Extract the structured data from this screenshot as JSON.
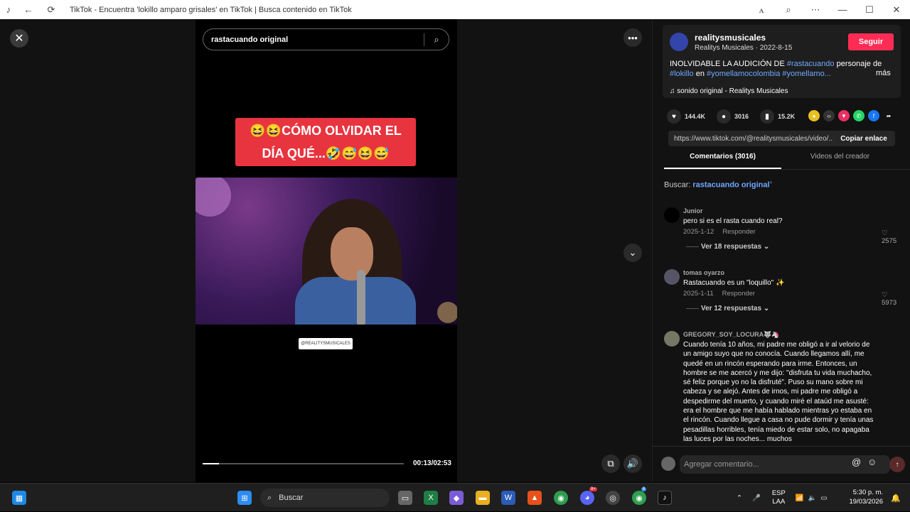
{
  "browser": {
    "title": "TikTok - Encuentra 'lokillo amparo grisales' en TikTok | Busca contenido en TikTok",
    "icons": [
      "tiktok-icon",
      "back-icon",
      "refresh-icon",
      "translate-icon",
      "zoom-icon",
      "more-icon",
      "minimize-icon",
      "maximize-icon",
      "close-icon"
    ]
  },
  "player": {
    "search_query": "rastacuando original",
    "caption_line1": "😆😆CÓMO OLVIDAR EL",
    "caption_line2": "DÍA QUÉ...🤣😅😆😅",
    "watermark": "@REALITYSMUSICALES",
    "progress": 0.08,
    "time": "00:13/02:53"
  },
  "creator": {
    "username": "realitysmusicales",
    "subtitle": "Realitys Musicales · 2022-8-15",
    "follow_label": "Seguir",
    "description_pre": "INOLVIDABLE LA AUDICIÓN DE ",
    "hashtag1": "#rastacuando",
    "description_mid": " personaje de ",
    "hashtag2": "#lokillo",
    "description_mid2": " en ",
    "hashtag3": "#yomellamocolombia",
    "hashtag4": " #yomellamo...",
    "more_label": "más",
    "sound": "♫  sonido original - Realitys Musicales"
  },
  "stats": {
    "likes": "144.4K",
    "comments": "3016",
    "saves": "15.2K"
  },
  "share": {
    "url": "https://www.tiktok.com/@realitysmusicales/video/...",
    "copy_label": "Copiar enlace"
  },
  "tabs": {
    "comments": "Comentarios (3016)",
    "creator_videos": "Videos del creador"
  },
  "search_label": "Buscar: ",
  "search_term": "rastacuando original",
  "comments": [
    {
      "user": "Junior",
      "text": "pero si es el rasta cuando real?",
      "date": "2025-1-12",
      "reply": "Responder",
      "likes": "♡ 2575",
      "view_replies": "Ver 18 respuestas ⌄"
    },
    {
      "user": "tomas oyarzo",
      "text": "Rastacuando es un \"loquillo\" ✨",
      "date": "2025-1-11",
      "reply": "Responder",
      "likes": "♡ 5973",
      "view_replies": "Ver 12 respuestas ⌄"
    },
    {
      "user": "GREGORY_SOY_LOCURA🐺🦄",
      "text": "Cuando tenía 10 años, mi padre me obligó a ir al velorio de un amigo suyo que no conocía. Cuando llegamos allí, me quedé en un rincón esperando para irme. Entonces, un hombre se me acercó y me dijo: \"disfruta tu vida muchacho, sé feliz porque yo no la disfruté\". Puso su mano sobre mi cabeza y se alejó. Antes de irnos, mi padre me obligó a despedirme del muerto, y cuando miré el ataúd me asusté: era el hombre que me había hablado mientras yo estaba en el rincón. Cuando llegue a casa no pude dormir y tenía unas pesadillas horribles, tenía miedo de estar solo, no apagaba las luces por las noches... muchos"
    }
  ],
  "comment_input": {
    "placeholder": "Agregar comentario...",
    "at": "@",
    "emoji": "☺",
    "send": "↑"
  },
  "taskbar": {
    "search_label": "Buscar",
    "lang_top": "ESP",
    "lang_bottom": "LAA",
    "time": "5:30 p. m.",
    "date": "19/03/2026",
    "badge_discord": "9+",
    "badge_chrome": "8"
  }
}
